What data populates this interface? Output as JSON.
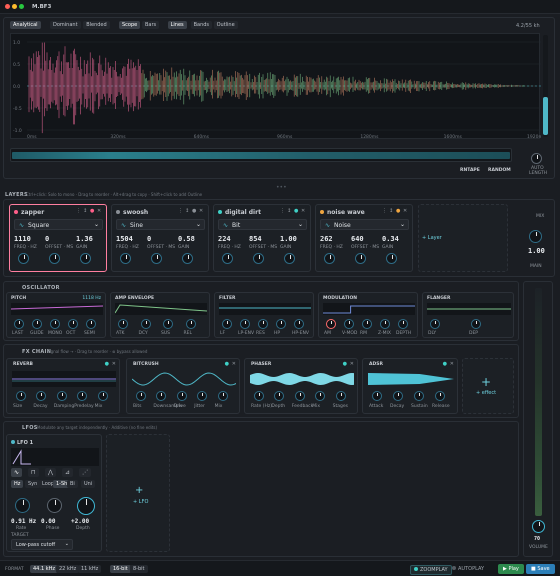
{
  "app": {
    "title": "M.BF3",
    "sr_readout": "4.2/55 kh"
  },
  "analyzer": {
    "view_tabs": [
      "Analytical",
      "Dominant",
      "Blended"
    ],
    "mode_tabs": [
      "Scope",
      "Bars"
    ],
    "style_tabs": [
      "Lines",
      "Bands",
      "Outline"
    ],
    "active_view": "Analytical",
    "active_mode": "Scope",
    "active_style": "Lines",
    "y_labels": [
      "1.0",
      "0.5",
      "0.0",
      "-0.5",
      "-1.0"
    ],
    "x_labels": [
      "0ms",
      "320ms",
      "640ms",
      "960ms",
      "1280ms",
      "1600ms",
      "1920ms"
    ],
    "waveform_color": "#4fb8c8",
    "controls": {
      "fill_label": "RNTAPE",
      "random_label": "RANDOM",
      "auto_label": "AUTO",
      "length_label": "LENGTH"
    }
  },
  "layers": {
    "section_label": "LAYERS",
    "hint": "Ctrl+click: Solo to mono · Drag to reorder · Alt+drag to copy · Shift+click to add Outline",
    "add_label": "+ Layer",
    "items": [
      {
        "name": "zapper",
        "color": "#ff5f8a",
        "active": true,
        "wave": "Square",
        "freq": "1110",
        "offset": "0",
        "gain": "1.36"
      },
      {
        "name": "swoosh",
        "color": "#8a8f96",
        "active": false,
        "wave": "Sine",
        "freq": "1504",
        "offset": "0",
        "gain": "0.58"
      },
      {
        "name": "digital dirt",
        "color": "#3fd0c6",
        "active": false,
        "wave": "Bit",
        "freq": "224",
        "offset": "854",
        "gain": "1.00"
      },
      {
        "name": "noise wave",
        "color": "#f0a640",
        "active": false,
        "wave": "Noise",
        "freq": "262",
        "offset": "640",
        "gain": "0.34"
      }
    ],
    "param_labels": [
      "FREQ · HZ",
      "OFFSET · MS",
      "GAIN"
    ],
    "main": {
      "label": "MAIN",
      "value": "1.00",
      "mix_label": "MIX"
    }
  },
  "oscillator": {
    "section_label": "OSCILLATOR",
    "pitch": {
      "title": "PITCH",
      "value": "1118 Hz",
      "knobs": [
        "LAST",
        "GLIDE",
        "MONO",
        "OCT",
        "SEMI"
      ]
    },
    "amp": {
      "title": "AMP ENVELOPE",
      "knobs": [
        "ATK",
        "DCY",
        "SUS",
        "REL"
      ]
    },
    "filter": {
      "title": "FILTER",
      "knobs": [
        "LF",
        "LP-ENV",
        "RES",
        "HP",
        "HP-ENV"
      ]
    },
    "modulation": {
      "title": "MODULATION",
      "knobs": [
        "AM",
        "V-MOD",
        "RM",
        "Z-MIX",
        "DEPTH"
      ]
    },
    "flanger": {
      "title": "FLANGER",
      "knobs": [
        "DLY",
        "DEP"
      ]
    }
  },
  "fx": {
    "section_label": "FX CHAIN",
    "hint": "Signal flow → · Drag to reorder · ⊗ bypass allowed",
    "add_label": "+ effect",
    "units": [
      {
        "title": "REVERB",
        "knobs": [
          "Size",
          "Decay",
          "Damping",
          "Predelay",
          "Mix"
        ]
      },
      {
        "title": "BITCRUSH",
        "knobs": [
          "Bits",
          "Downsample",
          "Drive",
          "Jitter",
          "Mix"
        ]
      },
      {
        "title": "PHASER",
        "knobs": [
          "Rate (Hz)",
          "Depth",
          "Feedback",
          "Mix",
          "Stages"
        ]
      },
      {
        "title": "ADSR",
        "knobs": [
          "Attack",
          "Decay",
          "Sustain",
          "Release"
        ]
      }
    ]
  },
  "lfo": {
    "section_label": "LFOS",
    "hint": "Modulate any target independently · Additive (no fine edits)",
    "add_label": "+ LFO",
    "card": {
      "title": "LFO 1",
      "wave_buttons": [
        "Hz",
        "Syn",
        "Loop",
        "1-Shot",
        "Bi",
        "Uni"
      ],
      "wave_sub": [
        "Mode",
        "",
        "Mode",
        "Trigger",
        "Polarity",
        ""
      ],
      "values": [
        {
          "v": "0.91 Hz",
          "l": "Rate"
        },
        {
          "v": "0.00",
          "l": "Phase"
        },
        {
          "v": "+2.00",
          "l": "Depth"
        }
      ],
      "target_label": "TARGET",
      "target": "Low-pass cutoff"
    }
  },
  "volume": {
    "label": "VOLUME",
    "value": "70"
  },
  "statusbar": {
    "format_label": "FORMAT",
    "rates": [
      "44.1 kHz",
      "22 kHz",
      "11 kHz"
    ],
    "bits": [
      "16-bit",
      "8-bit"
    ],
    "zoom": "ZOOMPLAY",
    "autoplay": "AUTOPLAY",
    "play": "Play",
    "save": "Save"
  }
}
